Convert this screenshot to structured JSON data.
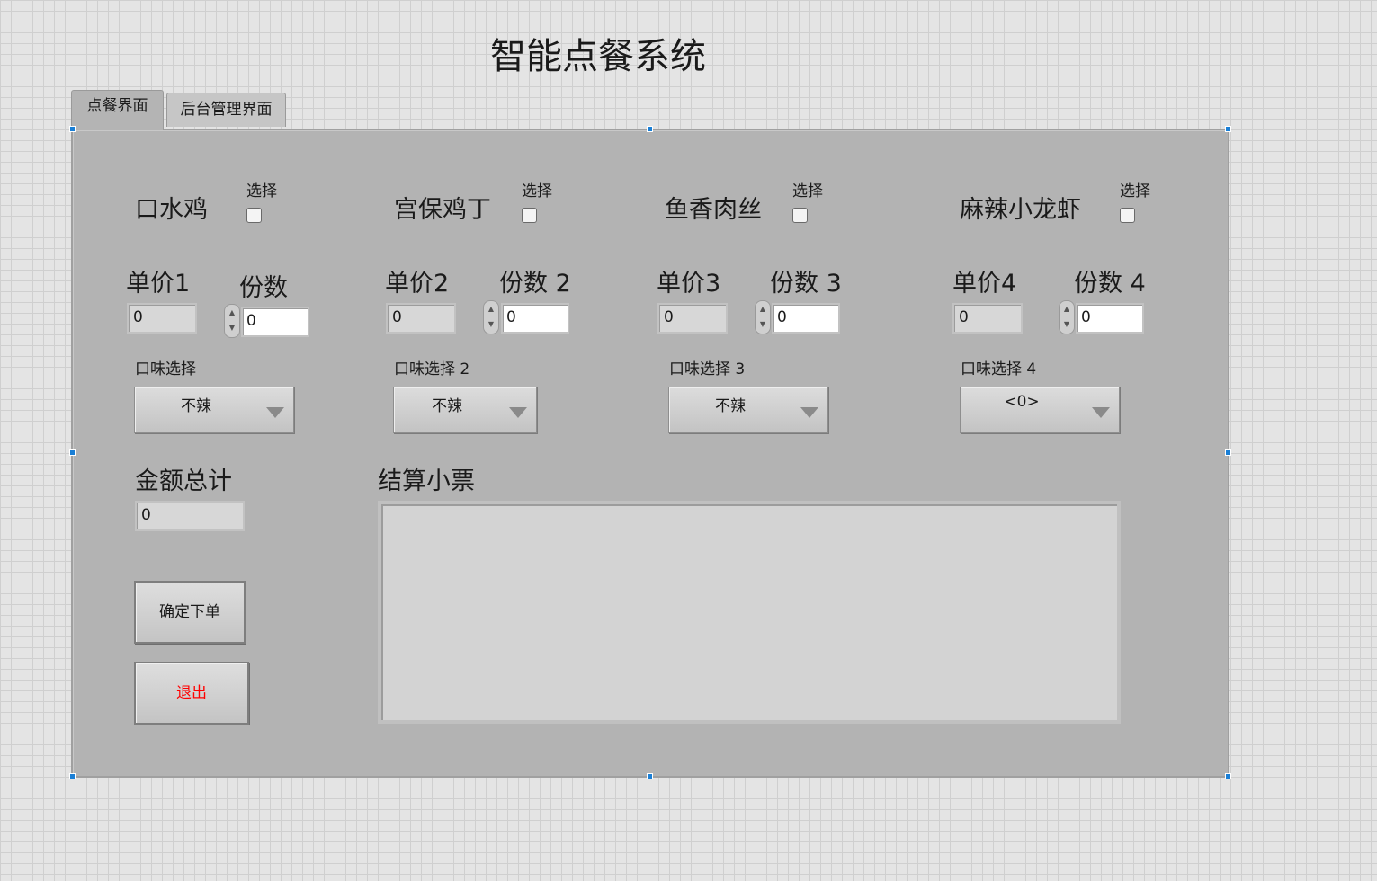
{
  "window": {
    "title": "智能点餐系统"
  },
  "tabs": [
    {
      "label": "点餐界面",
      "selected": true
    },
    {
      "label": "后台管理界面",
      "selected": false
    }
  ],
  "dishes": [
    {
      "name": "口水鸡",
      "select_label": "选择",
      "checked": false,
      "price_label": "单价1",
      "price_value": "0",
      "qty_label": "份数",
      "qty_value": "0",
      "flavor_label": "口味选择",
      "flavor_value": "不辣"
    },
    {
      "name": "宫保鸡丁",
      "select_label": "选择",
      "checked": false,
      "price_label": "单价2",
      "price_value": "0",
      "qty_label": "份数 2",
      "qty_value": "0",
      "flavor_label": "口味选择 2",
      "flavor_value": "不辣"
    },
    {
      "name": "鱼香肉丝",
      "select_label": "选择",
      "checked": false,
      "price_label": "单价3",
      "price_value": "0",
      "qty_label": "份数 3",
      "qty_value": "0",
      "flavor_label": "口味选择 3",
      "flavor_value": "不辣"
    },
    {
      "name": "麻辣小龙虾",
      "select_label": "选择",
      "checked": false,
      "price_label": "单价4",
      "price_value": "0",
      "qty_label": "份数 4",
      "qty_value": "0",
      "flavor_label": "口味选择 4",
      "flavor_value": "<0>"
    }
  ],
  "total": {
    "label": "金额总计",
    "value": "0"
  },
  "buttons": {
    "confirm": "确定下单",
    "exit": "退出",
    "exit_color": "#ff0000"
  },
  "receipt": {
    "label": "结算小票",
    "content": ""
  },
  "icons": {
    "spinner_up": "▲",
    "spinner_down": "▼",
    "dropdown": "triangle-down"
  }
}
